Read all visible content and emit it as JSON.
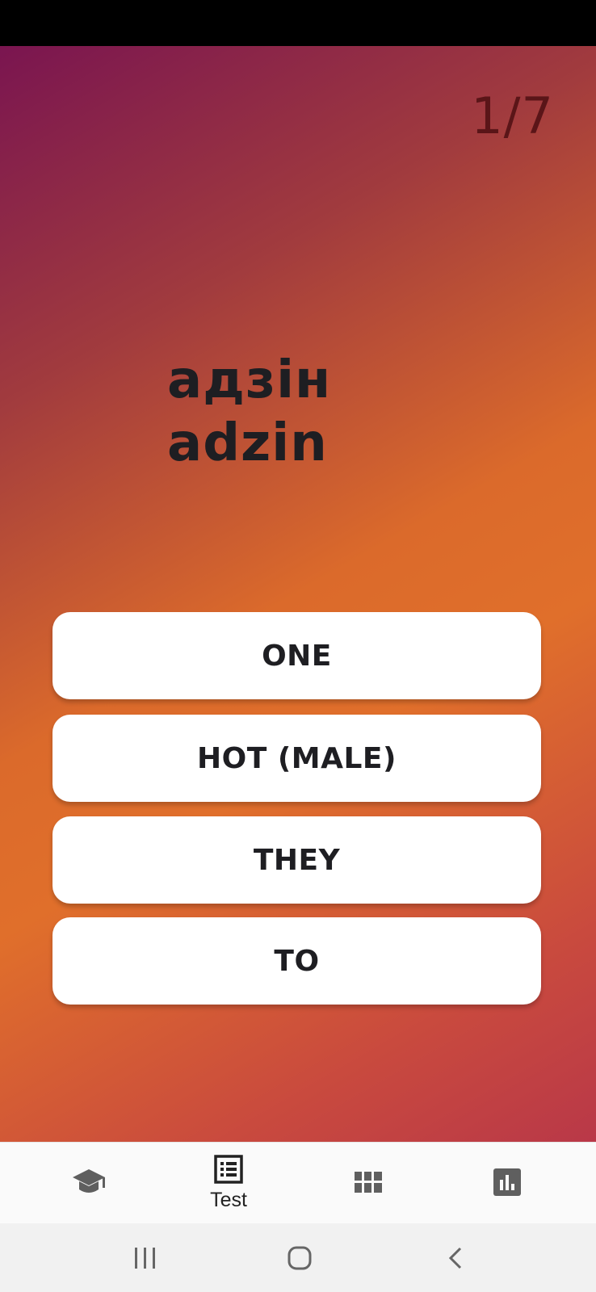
{
  "quiz": {
    "progress": "1/7",
    "word": {
      "native": "адзін",
      "transliteration": "adzin"
    },
    "answers": [
      {
        "label": "ONE"
      },
      {
        "label": "HOT (MALE)"
      },
      {
        "label": "THEY"
      },
      {
        "label": "TO"
      }
    ]
  },
  "bottom_nav": {
    "items": [
      {
        "icon": "graduation-cap-icon",
        "label": ""
      },
      {
        "icon": "list-icon",
        "label": "Test",
        "active": true
      },
      {
        "icon": "grid-icon",
        "label": ""
      },
      {
        "icon": "bar-chart-icon",
        "label": ""
      }
    ]
  },
  "system_nav": {
    "recents": "recents-icon",
    "home": "home-icon",
    "back": "back-icon"
  },
  "colors": {
    "gradient_start": "#7a1550",
    "gradient_mid": "#e06f2b",
    "gradient_end": "#b93848",
    "progress_text": "#5a1518",
    "answer_bg": "#ffffff",
    "text_dark": "#1e1e22"
  }
}
